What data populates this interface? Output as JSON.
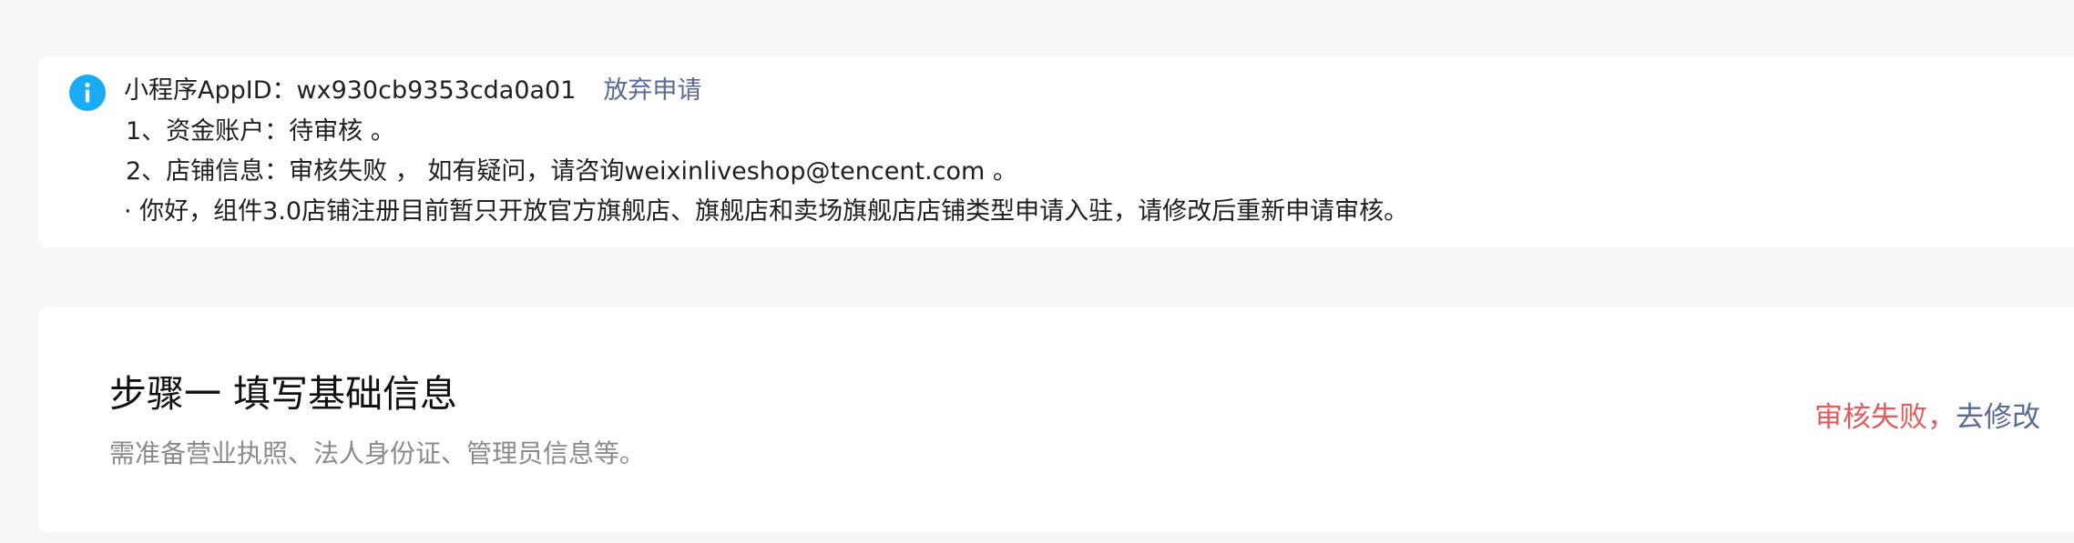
{
  "notice": {
    "icon": "info-icon",
    "icon_color": "#1aabf5",
    "appid_label": "小程序AppID：",
    "appid_value": "wx930cb9353cda0a01",
    "abandon_link": "放弃申请",
    "line_funds": "1、资金账户：待审核 。",
    "line_store": "2、店铺信息：审核失败 ，  如有疑问，请咨询weixinliveshop@tencent.com 。",
    "line_reason": "· 你好，组件3.0店铺注册目前暂只开放官方旗舰店、旗舰店和卖场旗舰店店铺类型申请入驻，请修改后重新申请审核。"
  },
  "step": {
    "title": "步骤一 填写基础信息",
    "description": "需准备营业执照、法人身份证、管理员信息等。",
    "status_fail": "审核失败",
    "status_sep": "，",
    "status_action": "去修改"
  },
  "colors": {
    "background": "#f6f7f9",
    "link": "#576b95",
    "fail": "#e15c5c"
  }
}
